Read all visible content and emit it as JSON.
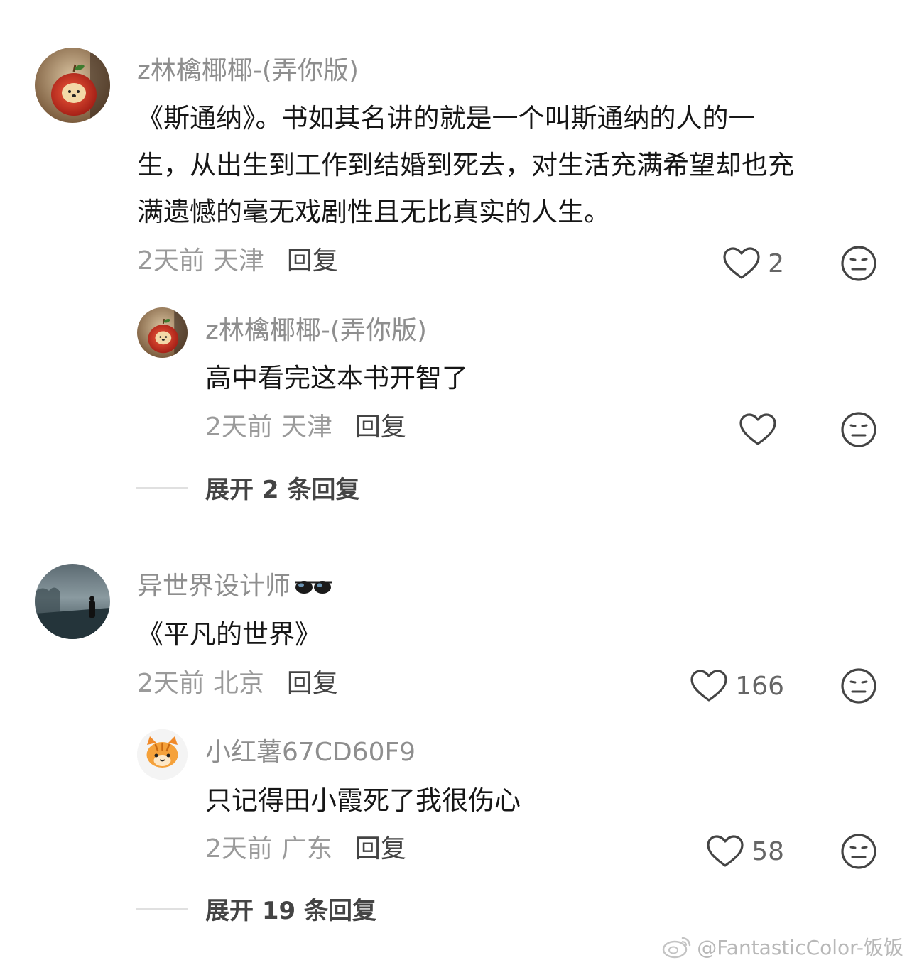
{
  "comments": [
    {
      "username": "z林檎椰椰-(弄你版)",
      "text_lines": [
        "《斯通纳》。书如其名讲的就是一个叫斯通纳的人的一",
        "生，从出生到工作到结婚到死去，对生活充满希望却也充",
        "满遗憾的毫无戏剧性且无比真实的人生。"
      ],
      "time": "2天前",
      "location": "天津",
      "reply_label": "回复",
      "likes": "2",
      "replies": [
        {
          "username": "z林檎椰椰-(弄你版)",
          "text": "高中看完这本书开智了",
          "time": "2天前",
          "location": "天津",
          "reply_label": "回复",
          "likes": ""
        }
      ],
      "expand_label": "展开 2 条回复"
    },
    {
      "username": "异世界设计师",
      "username_icon": "sunglasses-icon",
      "text": "《平凡的世界》",
      "time": "2天前",
      "location": "北京",
      "reply_label": "回复",
      "likes": "166",
      "replies": [
        {
          "username": "小红薯67CD60F9",
          "text": "只记得田小霞死了我很伤心",
          "time": "2天前",
          "location": "广东",
          "reply_label": "回复",
          "likes": "58"
        }
      ],
      "expand_label": "展开 19 条回复"
    }
  ],
  "watermark": "@FantasticColor-饭饭",
  "colors": {
    "username": "#8e8e8e",
    "meta": "#9a9a9a",
    "text": "#161616",
    "icon_stroke": "#444444"
  }
}
